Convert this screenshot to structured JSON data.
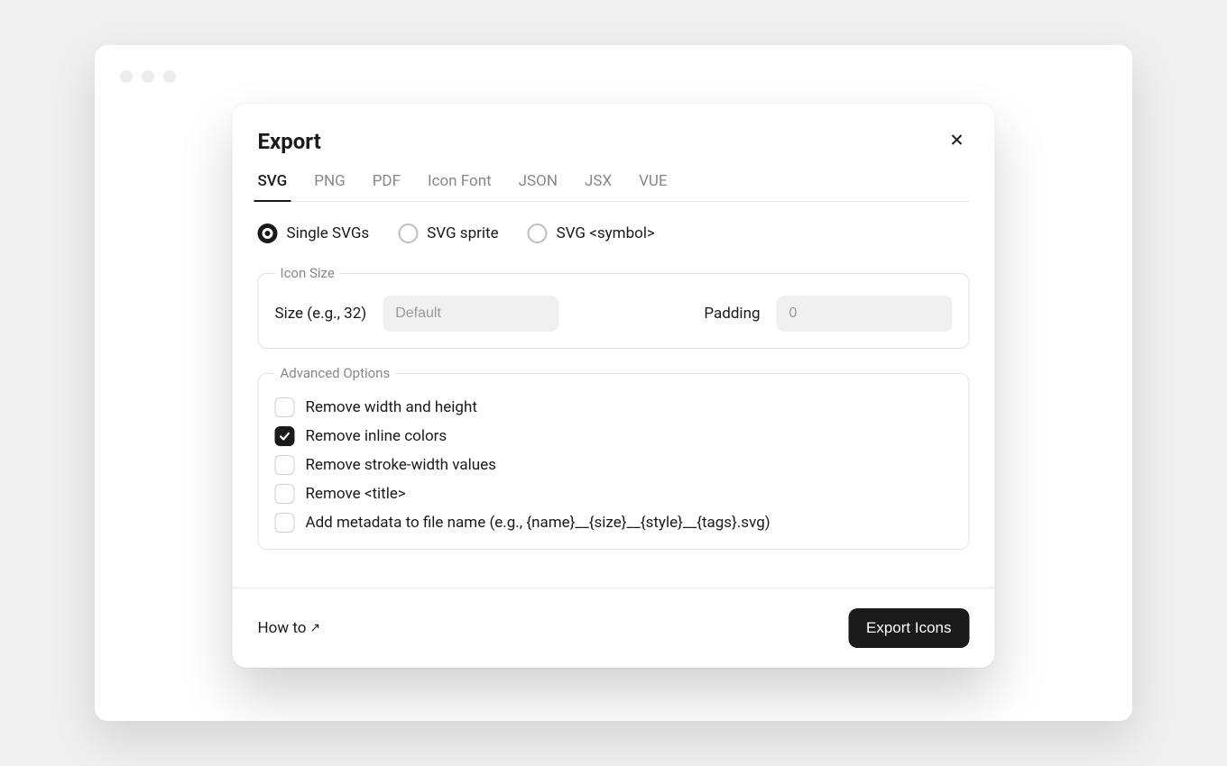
{
  "modal": {
    "title": "Export",
    "tabs": [
      "SVG",
      "PNG",
      "PDF",
      "Icon Font",
      "JSON",
      "JSX",
      "VUE"
    ],
    "active_tab": "SVG",
    "svg_modes": {
      "single": "Single SVGs",
      "sprite": "SVG sprite",
      "symbol": "SVG <symbol>",
      "selected": "single"
    },
    "icon_size": {
      "legend": "Icon Size",
      "size_label": "Size (e.g., 32)",
      "size_placeholder": "Default",
      "size_value": "",
      "padding_label": "Padding",
      "padding_placeholder": "0",
      "padding_value": ""
    },
    "advanced": {
      "legend": "Advanced Options",
      "options": [
        {
          "label": "Remove width and height",
          "checked": false
        },
        {
          "label": "Remove inline colors",
          "checked": true
        },
        {
          "label": "Remove stroke-width values",
          "checked": false
        },
        {
          "label": "Remove <title>",
          "checked": false
        },
        {
          "label": "Add metadata to file name (e.g., {name}__{size}__{style}__{tags}.svg)",
          "checked": false
        }
      ]
    },
    "footer": {
      "howto": "How to",
      "export_button": "Export Icons"
    }
  }
}
